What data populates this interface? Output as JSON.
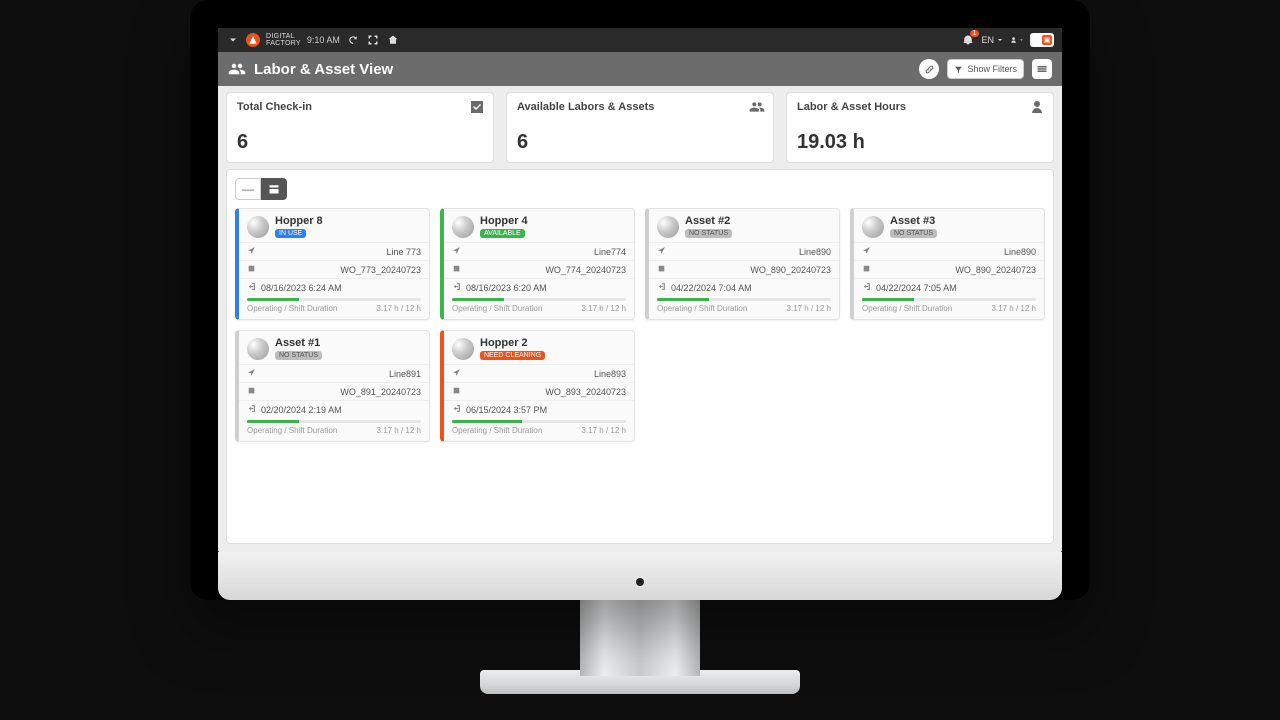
{
  "topbar": {
    "brand_top": "DIGITAL",
    "brand_bot": "FACTORY",
    "time": "9:10 AM",
    "language": "EN",
    "notif_count": "1"
  },
  "header": {
    "title": "Labor & Asset View",
    "show_filters": "Show Filters"
  },
  "stats": [
    {
      "label": "Total Check-in",
      "value": "6"
    },
    {
      "label": "Available Labors & Assets",
      "value": "6"
    },
    {
      "label": "Labor & Asset Hours",
      "value": "19.03 h"
    }
  ],
  "card_labels": {
    "op_shift": "Operating / Shift Duration",
    "duration": "3.17 h / 12 h"
  },
  "cards": [
    {
      "name": "Hopper 8",
      "status": "IN USE",
      "status_cls": "inuse",
      "border": "bl-blue",
      "line": "Line 773",
      "wo": "WO_773_20240723",
      "ts": "08/16/2023 6:24 AM",
      "bar": 30
    },
    {
      "name": "Hopper 4",
      "status": "AVAILABLE",
      "status_cls": "avail",
      "border": "bl-green",
      "line": "Line774",
      "wo": "WO_774_20240723",
      "ts": "08/16/2023 6:20 AM",
      "bar": 30
    },
    {
      "name": "Asset #2",
      "status": "NO STATUS",
      "status_cls": "nostat",
      "border": "bl-grey",
      "line": "Line890",
      "wo": "WO_890_20240723",
      "ts": "04/22/2024 7:04 AM",
      "bar": 30
    },
    {
      "name": "Asset #3",
      "status": "NO STATUS",
      "status_cls": "nostat",
      "border": "bl-grey",
      "line": "Line890",
      "wo": "WO_890_20240723",
      "ts": "04/22/2024 7:05 AM",
      "bar": 30
    },
    {
      "name": "Asset #1",
      "status": "NO STATUS",
      "status_cls": "nostat",
      "border": "bl-grey",
      "line": "Line891",
      "wo": "WO_891_20240723",
      "ts": "02/20/2024 2:19 AM",
      "bar": 30
    },
    {
      "name": "Hopper 2",
      "status": "NEED CLEANING",
      "status_cls": "clean",
      "border": "bl-red",
      "line": "Line893",
      "wo": "WO_893_20240723",
      "ts": "06/15/2024 3:57 PM",
      "bar": 40
    }
  ]
}
